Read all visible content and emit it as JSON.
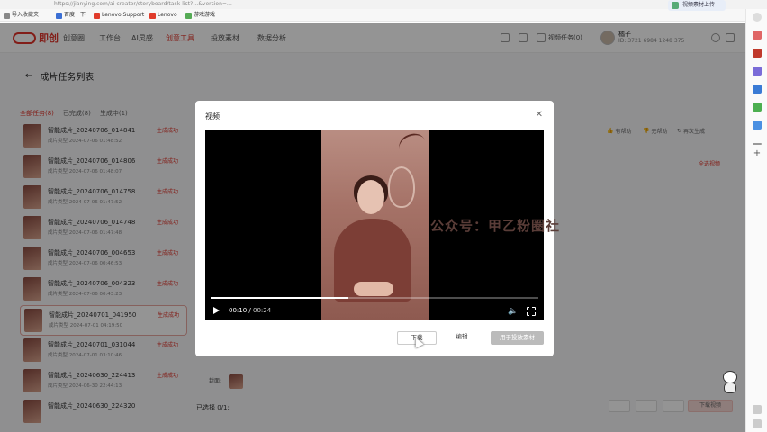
{
  "browser": {
    "url": "https://jianying.com/ai-creator/storyboard/task-list?…&version=…",
    "bookmarks": [
      {
        "label": "导入收藏夹",
        "color": "#888888"
      },
      {
        "label": "百度一下",
        "color": "#3b6fd4"
      },
      {
        "label": "Lenovo Support",
        "color": "#e03b2b"
      },
      {
        "label": "Lenovo",
        "color": "#e03b2b"
      },
      {
        "label": "游戏游戏",
        "color": "#55aa55"
      }
    ],
    "upload_chip": "视频素材上传"
  },
  "nav": {
    "logo_text": "即创",
    "items": [
      "创意圈",
      "工作台",
      "AI灵感",
      "创意工具",
      "投放素材",
      "数据分析"
    ],
    "active_index": 3,
    "right_items": [
      "",
      "",
      "视频任务(0)"
    ],
    "user_name": "橘子",
    "user_id": "ID: 3721 6984 1248 375"
  },
  "page": {
    "title": "成片任务列表",
    "tabs": [
      {
        "label": "全部任务(8)",
        "active": true
      },
      {
        "label": "已完成(8)",
        "active": false
      },
      {
        "label": "生成中(1)",
        "active": false
      }
    ],
    "rows": [
      {
        "name": "智能成片_20240706_014841",
        "meta": "成片类型  2024-07-06 01:48:52",
        "status": "生成成功",
        "selected": false
      },
      {
        "name": "智能成片_20240706_014806",
        "meta": "成片类型  2024-07-06 01:48:07",
        "status": "生成成功",
        "selected": false
      },
      {
        "name": "智能成片_20240706_014758",
        "meta": "成片类型  2024-07-06 01:47:52",
        "status": "生成成功",
        "selected": false
      },
      {
        "name": "智能成片_20240706_014748",
        "meta": "成片类型  2024-07-06 01:47:48",
        "status": "生成成功",
        "selected": false
      },
      {
        "name": "智能成片_20240706_004653",
        "meta": "成片类型  2024-07-06 00:46:53",
        "status": "生成成功",
        "selected": false
      },
      {
        "name": "智能成片_20240706_004323",
        "meta": "成片类型  2024-07-06 00:43:23",
        "status": "生成成功",
        "selected": false
      },
      {
        "name": "智能成片_20240701_041950",
        "meta": "成片类型  2024-07-01 04:19:50",
        "status": "生成成功",
        "selected": true
      },
      {
        "name": "智能成片_20240701_031044",
        "meta": "成片类型  2024-07-01 03:10:46",
        "status": "生成成功",
        "selected": false
      },
      {
        "name": "智能成片_20240630_224413",
        "meta": "成片类型  2024-06-30 22:44:13",
        "status": "生成成功",
        "selected": false
      },
      {
        "name": "智能成片_20240630_224320",
        "meta": "",
        "status": "",
        "selected": false
      }
    ],
    "right_actions": [
      "有帮助",
      "无帮助",
      "再次生成"
    ],
    "select_all": "全选视频",
    "cover_label": "封面:",
    "selected_count": "已选择 0/1:",
    "footer_buttons": [
      "",
      "",
      "",
      "下载视频"
    ]
  },
  "modal": {
    "title": "视频",
    "close_icon": "close-icon",
    "watermark": "公众号：甲乙粉圈社",
    "current_time": "00:10",
    "duration": "00:24",
    "progress": 0.42,
    "buttons": {
      "download": "下载",
      "edit": "编辑",
      "primary": "用于投放素材"
    }
  }
}
